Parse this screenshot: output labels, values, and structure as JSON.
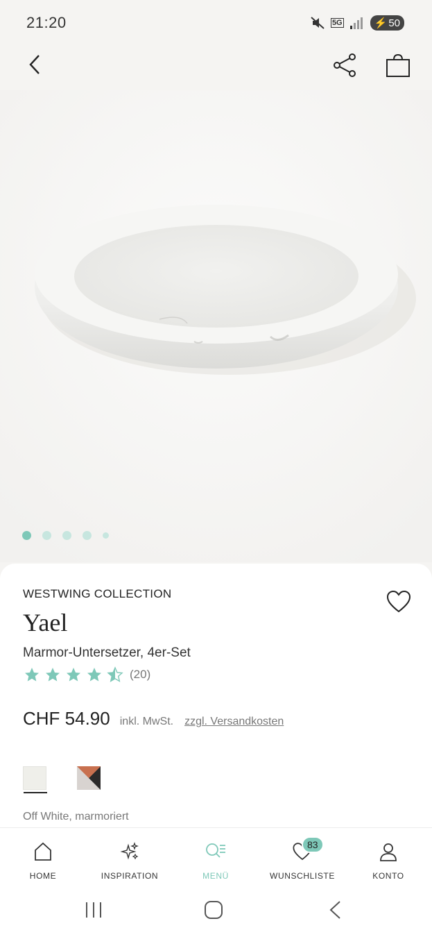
{
  "status_bar": {
    "time": "21:20",
    "battery": "50",
    "network": "5G"
  },
  "topbar": {
    "icons": [
      "chevron-left-icon",
      "share-icon",
      "shopping-bag-icon"
    ]
  },
  "gallery": {
    "image_count": 5,
    "active_index": 0
  },
  "product": {
    "brand": "WESTWING COLLECTION",
    "name": "Yael",
    "subtitle": "Marmor-Untersetzer, 4er-Set",
    "rating_value": 4.5,
    "rating_count": "(20)",
    "price": "CHF 54.90",
    "vat": "inkl. MwSt.",
    "shipping": "zzgl. Versandkosten",
    "selected_color": "Off White, marmoriert"
  },
  "bottom_nav": {
    "items": [
      {
        "label": "HOME",
        "icon": "home-icon"
      },
      {
        "label": "INSPIRATION",
        "icon": "sparkle-icon"
      },
      {
        "label": "MENÜ",
        "icon": "search-menu-icon"
      },
      {
        "label": "WUNSCHLISTE",
        "icon": "heart-icon",
        "badge": "83"
      },
      {
        "label": "KONTO",
        "icon": "user-icon"
      }
    ],
    "active": "MENÜ"
  },
  "colors": {
    "accent": "#7ec8b8",
    "accent_light": "#c7e6df"
  }
}
